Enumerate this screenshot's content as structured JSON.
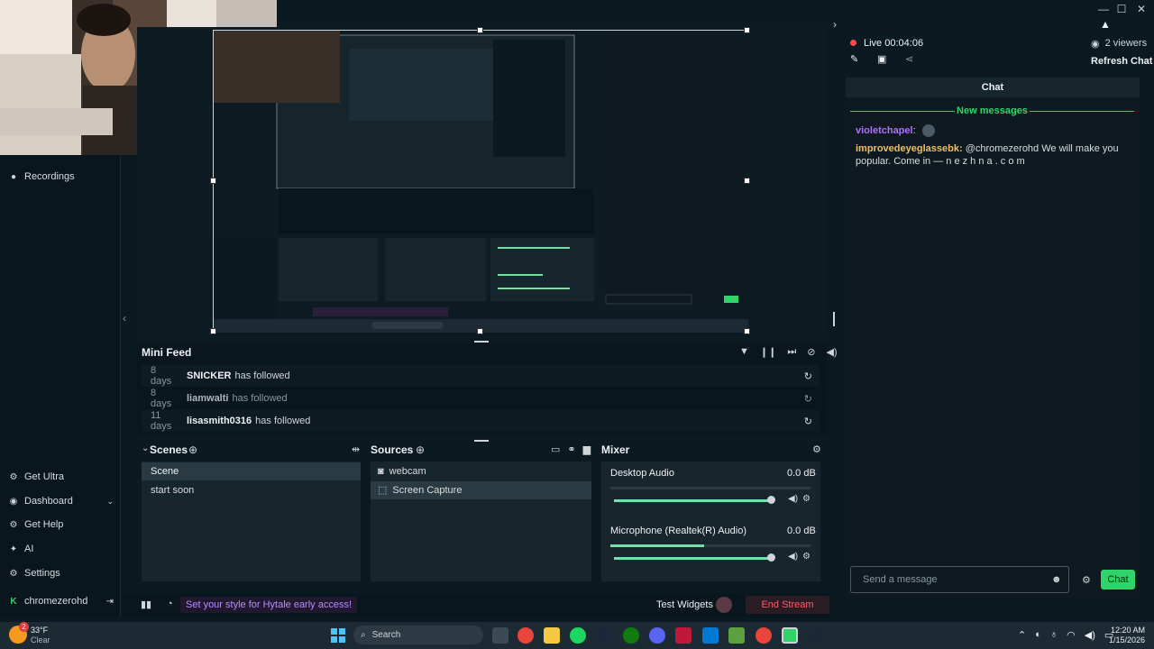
{
  "window": {
    "minimize_icon": "minimize-icon",
    "maximize_icon": "maximize-icon",
    "close_icon": "close-icon"
  },
  "leftnav": {
    "recordings": "Recordings",
    "items": [
      {
        "label": "Get Ultra",
        "icon": "ultra-icon"
      },
      {
        "label": "Dashboard",
        "icon": "dashboard-icon"
      },
      {
        "label": "Get Help",
        "icon": "help-icon"
      },
      {
        "label": "AI",
        "icon": "ai-icon"
      },
      {
        "label": "Settings",
        "icon": "gear-icon"
      }
    ],
    "user": "chromezerohd"
  },
  "chat": {
    "live_label": "Live",
    "live_time": "00:04:06",
    "viewers": "2 viewers",
    "refresh": "Refresh Chat",
    "header": "Chat",
    "new_messages": "New messages",
    "messages": [
      {
        "user": "violetchapel",
        "text": ""
      },
      {
        "user": "improvedeyeglassebk",
        "text": "@chromezerohd We will make you popular. Come in — n e z h n a . c o m"
      }
    ],
    "input_placeholder": "Send a message",
    "send": "Chat"
  },
  "minifeed": {
    "title": "Mini Feed",
    "rows": [
      {
        "time": "8 days",
        "user": "SNICKER",
        "action": "has followed"
      },
      {
        "time": "8 days",
        "user": "liamwalti",
        "action": "has followed"
      },
      {
        "time": "11 days",
        "user": "lisasmith0316",
        "action": "has followed"
      }
    ]
  },
  "scenes": {
    "title": "Scenes",
    "items": [
      "Scene",
      "start soon"
    ]
  },
  "sources": {
    "title": "Sources",
    "items": [
      "webcam",
      "Screen Capture"
    ]
  },
  "mixer": {
    "title": "Mixer",
    "tracks": [
      {
        "name": "Desktop Audio",
        "db": "0.0 dB",
        "level": 0.0,
        "volume": 1.0
      },
      {
        "name": "Microphone (Realtek(R) Audio)",
        "db": "0.0 dB",
        "level": 0.47,
        "volume": 1.0
      }
    ]
  },
  "footer": {
    "promo": "Set your style for Hytale early access!",
    "test_widgets": "Test Widgets",
    "end_stream": "End Stream"
  },
  "taskbar": {
    "temp": "33°F",
    "weather": "Clear",
    "search": "Search",
    "time": "12:20 AM",
    "date": "1/15/2026",
    "badge": "2"
  },
  "colors": {
    "accent": "#2fd36a",
    "live": "#ff4b4b",
    "user1": "#b070ff",
    "user2": "#f0c060",
    "promo": "#b98bff",
    "end": "#ff5c6e"
  }
}
